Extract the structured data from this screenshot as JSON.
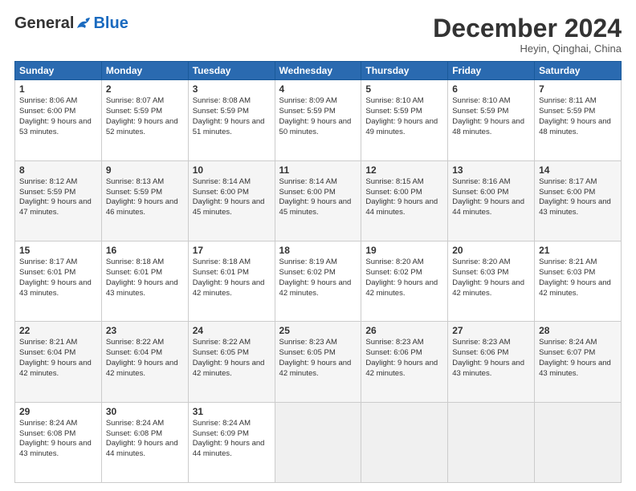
{
  "logo": {
    "general": "General",
    "blue": "Blue"
  },
  "header": {
    "month": "December 2024",
    "location": "Heyin, Qinghai, China"
  },
  "days": [
    "Sunday",
    "Monday",
    "Tuesday",
    "Wednesday",
    "Thursday",
    "Friday",
    "Saturday"
  ],
  "weeks": [
    [
      {
        "day": "1",
        "sunrise": "8:06 AM",
        "sunset": "6:00 PM",
        "daylight": "9 hours and 53 minutes."
      },
      {
        "day": "2",
        "sunrise": "8:07 AM",
        "sunset": "5:59 PM",
        "daylight": "9 hours and 52 minutes."
      },
      {
        "day": "3",
        "sunrise": "8:08 AM",
        "sunset": "5:59 PM",
        "daylight": "9 hours and 51 minutes."
      },
      {
        "day": "4",
        "sunrise": "8:09 AM",
        "sunset": "5:59 PM",
        "daylight": "9 hours and 50 minutes."
      },
      {
        "day": "5",
        "sunrise": "8:10 AM",
        "sunset": "5:59 PM",
        "daylight": "9 hours and 49 minutes."
      },
      {
        "day": "6",
        "sunrise": "8:10 AM",
        "sunset": "5:59 PM",
        "daylight": "9 hours and 48 minutes."
      },
      {
        "day": "7",
        "sunrise": "8:11 AM",
        "sunset": "5:59 PM",
        "daylight": "9 hours and 48 minutes."
      }
    ],
    [
      {
        "day": "8",
        "sunrise": "8:12 AM",
        "sunset": "5:59 PM",
        "daylight": "9 hours and 47 minutes."
      },
      {
        "day": "9",
        "sunrise": "8:13 AM",
        "sunset": "5:59 PM",
        "daylight": "9 hours and 46 minutes."
      },
      {
        "day": "10",
        "sunrise": "8:14 AM",
        "sunset": "6:00 PM",
        "daylight": "9 hours and 45 minutes."
      },
      {
        "day": "11",
        "sunrise": "8:14 AM",
        "sunset": "6:00 PM",
        "daylight": "9 hours and 45 minutes."
      },
      {
        "day": "12",
        "sunrise": "8:15 AM",
        "sunset": "6:00 PM",
        "daylight": "9 hours and 44 minutes."
      },
      {
        "day": "13",
        "sunrise": "8:16 AM",
        "sunset": "6:00 PM",
        "daylight": "9 hours and 44 minutes."
      },
      {
        "day": "14",
        "sunrise": "8:17 AM",
        "sunset": "6:00 PM",
        "daylight": "9 hours and 43 minutes."
      }
    ],
    [
      {
        "day": "15",
        "sunrise": "8:17 AM",
        "sunset": "6:01 PM",
        "daylight": "9 hours and 43 minutes."
      },
      {
        "day": "16",
        "sunrise": "8:18 AM",
        "sunset": "6:01 PM",
        "daylight": "9 hours and 43 minutes."
      },
      {
        "day": "17",
        "sunrise": "8:18 AM",
        "sunset": "6:01 PM",
        "daylight": "9 hours and 42 minutes."
      },
      {
        "day": "18",
        "sunrise": "8:19 AM",
        "sunset": "6:02 PM",
        "daylight": "9 hours and 42 minutes."
      },
      {
        "day": "19",
        "sunrise": "8:20 AM",
        "sunset": "6:02 PM",
        "daylight": "9 hours and 42 minutes."
      },
      {
        "day": "20",
        "sunrise": "8:20 AM",
        "sunset": "6:03 PM",
        "daylight": "9 hours and 42 minutes."
      },
      {
        "day": "21",
        "sunrise": "8:21 AM",
        "sunset": "6:03 PM",
        "daylight": "9 hours and 42 minutes."
      }
    ],
    [
      {
        "day": "22",
        "sunrise": "8:21 AM",
        "sunset": "6:04 PM",
        "daylight": "9 hours and 42 minutes."
      },
      {
        "day": "23",
        "sunrise": "8:22 AM",
        "sunset": "6:04 PM",
        "daylight": "9 hours and 42 minutes."
      },
      {
        "day": "24",
        "sunrise": "8:22 AM",
        "sunset": "6:05 PM",
        "daylight": "9 hours and 42 minutes."
      },
      {
        "day": "25",
        "sunrise": "8:23 AM",
        "sunset": "6:05 PM",
        "daylight": "9 hours and 42 minutes."
      },
      {
        "day": "26",
        "sunrise": "8:23 AM",
        "sunset": "6:06 PM",
        "daylight": "9 hours and 42 minutes."
      },
      {
        "day": "27",
        "sunrise": "8:23 AM",
        "sunset": "6:06 PM",
        "daylight": "9 hours and 43 minutes."
      },
      {
        "day": "28",
        "sunrise": "8:24 AM",
        "sunset": "6:07 PM",
        "daylight": "9 hours and 43 minutes."
      }
    ],
    [
      {
        "day": "29",
        "sunrise": "8:24 AM",
        "sunset": "6:08 PM",
        "daylight": "9 hours and 43 minutes."
      },
      {
        "day": "30",
        "sunrise": "8:24 AM",
        "sunset": "6:08 PM",
        "daylight": "9 hours and 44 minutes."
      },
      {
        "day": "31",
        "sunrise": "8:24 AM",
        "sunset": "6:09 PM",
        "daylight": "9 hours and 44 minutes."
      },
      null,
      null,
      null,
      null
    ]
  ],
  "labels": {
    "sunrise": "Sunrise:",
    "sunset": "Sunset:",
    "daylight": "Daylight:"
  }
}
